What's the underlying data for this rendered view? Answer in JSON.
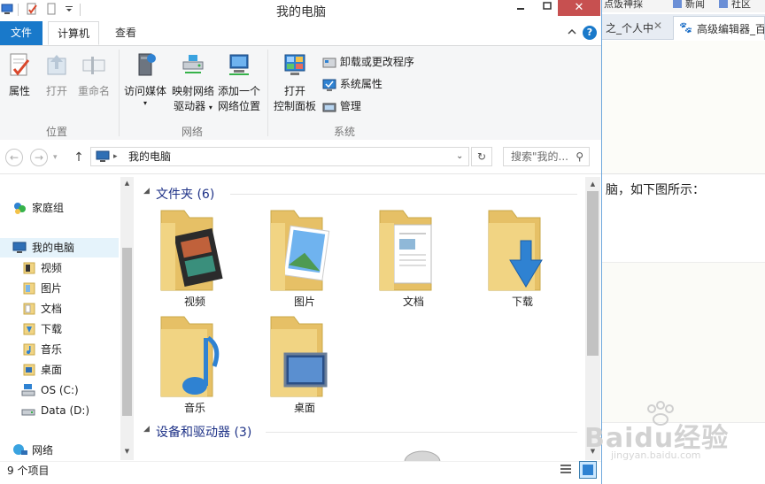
{
  "window": {
    "title": "我的电脑"
  },
  "ribbon_tabs": [
    "文件",
    "计算机",
    "查看"
  ],
  "ribbon": {
    "groups": [
      {
        "label": "位置",
        "buttons": [
          "属性",
          "打开",
          "重命名"
        ]
      },
      {
        "label": "网络",
        "buttons": [
          [
            "访问媒体"
          ],
          [
            "映射网络",
            "驱动器"
          ],
          [
            "添加一个",
            "网络位置"
          ]
        ]
      },
      {
        "label": "系统",
        "big": [
          "打开",
          "控制面板"
        ],
        "small": [
          "卸载或更改程序",
          "系统属性",
          "管理"
        ]
      }
    ]
  },
  "address": {
    "path": "我的电脑",
    "search_placeholder": "搜索\"我的..."
  },
  "nav": {
    "homegroup": "家庭组",
    "computer": "我的电脑",
    "items": [
      "视频",
      "图片",
      "文档",
      "下载",
      "音乐",
      "桌面",
      "OS (C:)",
      "Data (D:)"
    ],
    "network": "网络"
  },
  "content": {
    "folders_header": "文件夹 (6)",
    "folders": [
      "视频",
      "图片",
      "文档",
      "下载",
      "音乐",
      "桌面"
    ],
    "devices_header": "设备和驱动器 (3)"
  },
  "status": {
    "count": "9 个项目"
  },
  "browser": {
    "tabs": [
      "之_个人中",
      "高级编辑器_百"
    ],
    "bookmarks": [
      "点饭神採",
      "新闻",
      "社区"
    ],
    "body_text": "脑，如下图所示：",
    "watermark": "Baidu经验",
    "watermark_sub": "jingyan.baidu.com"
  },
  "colors": {
    "file_tab": "#1979ca",
    "close_button": "#c75050",
    "group_header": "#1e3287",
    "folder": "#f1d483"
  }
}
